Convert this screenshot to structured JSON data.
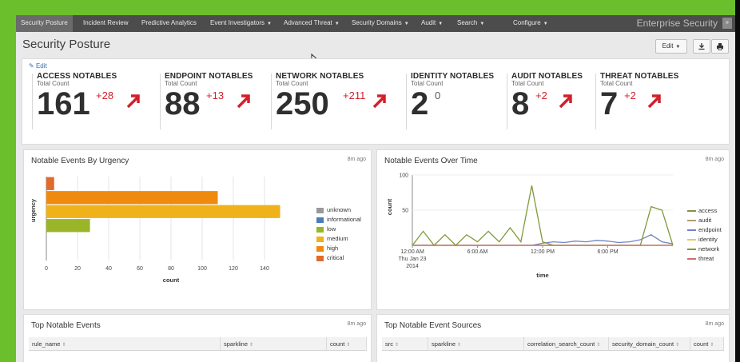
{
  "nav": {
    "items": [
      {
        "label": "Security Posture",
        "active": true,
        "caret": false
      },
      {
        "label": "Incident Review",
        "caret": false
      },
      {
        "label": "Predictive Analytics",
        "caret": false
      },
      {
        "label": "Event Investigators",
        "caret": true
      },
      {
        "label": "Advanced Threat",
        "caret": true
      },
      {
        "label": "Security Domains",
        "caret": true
      },
      {
        "label": "Audit",
        "caret": true
      },
      {
        "label": "Search",
        "caret": true
      },
      {
        "label": "Configure",
        "caret": true
      }
    ],
    "brand": "Enterprise Security",
    "brand_icon": "»"
  },
  "page": {
    "title": "Security Posture",
    "edit_button": "Edit",
    "edit_link": "Edit"
  },
  "kpis": [
    {
      "label": "ACCESS NOTABLES",
      "sub": "Total Count",
      "value": "161",
      "delta": "+28",
      "trend": "up"
    },
    {
      "label": "ENDPOINT NOTABLES",
      "sub": "Total Count",
      "value": "88",
      "delta": "+13",
      "trend": "up"
    },
    {
      "label": "NETWORK NOTABLES",
      "sub": "Total Count",
      "value": "250",
      "delta": "+211",
      "trend": "up"
    },
    {
      "label": "IDENTITY NOTABLES",
      "sub": "Total Count",
      "value": "2",
      "delta": "0",
      "trend": "none"
    },
    {
      "label": "AUDIT NOTABLES",
      "sub": "Total Count",
      "value": "8",
      "delta": "+2",
      "trend": "up"
    },
    {
      "label": "THREAT NOTABLES",
      "sub": "Total Count",
      "value": "7",
      "delta": "+2",
      "trend": "up"
    }
  ],
  "colors": {
    "accent_red": "#d0212b",
    "unknown": "#999999",
    "informational": "#4a7ebb",
    "low": "#9bb529",
    "medium": "#f0b21a",
    "high": "#f08a0e",
    "critical": "#e26a2c",
    "access": "#8a8f44",
    "audit": "#b79a6e",
    "endpoint": "#6f86c6",
    "identity": "#e8c85a",
    "network": "#7f9a3a",
    "threat": "#cf6f6f"
  },
  "urgency_panel": {
    "title": "Notable Events By Urgency",
    "ago": "8m ago",
    "chart_data": {
      "type": "bar",
      "orientation": "horizontal",
      "categories": [
        "critical",
        "high",
        "medium",
        "low",
        "informational",
        "unknown"
      ],
      "values": [
        5,
        110,
        150,
        28,
        0,
        0
      ],
      "xlabel": "count",
      "ylabel": "urgency",
      "xlim": [
        0,
        160
      ],
      "xticks": [
        "0",
        "20",
        "40",
        "60",
        "80",
        "100",
        "120",
        "140"
      ],
      "legend": [
        "unknown",
        "informational",
        "low",
        "medium",
        "high",
        "critical"
      ],
      "legend_position": "right",
      "grid": true
    }
  },
  "time_panel": {
    "title": "Notable Events Over Time",
    "ago": "8m ago",
    "chart_data": {
      "type": "line",
      "xlabel": "time",
      "ylabel": "count",
      "ylim": [
        0,
        100
      ],
      "yticks": [
        "100",
        "50"
      ],
      "xticks": [
        {
          "label": "12:00 AM",
          "sub": "Thu Jan 23",
          "sub2": "2014"
        },
        {
          "label": "6:00 AM"
        },
        {
          "label": "12:00 PM"
        },
        {
          "label": "6:00 PM"
        }
      ],
      "x_hours": [
        0,
        1,
        2,
        3,
        4,
        5,
        6,
        7,
        8,
        9,
        10,
        11,
        12,
        13,
        14,
        15,
        16,
        17,
        18,
        19,
        20,
        21,
        22,
        23,
        24
      ],
      "series": [
        {
          "name": "access",
          "values": [
            0,
            0,
            0,
            0,
            0,
            0,
            0,
            0,
            0,
            0,
            0,
            0,
            0,
            0,
            0,
            0,
            0,
            0,
            0,
            0,
            0,
            0,
            0,
            0,
            0
          ]
        },
        {
          "name": "audit",
          "values": [
            0,
            0,
            0,
            0,
            0,
            0,
            0,
            0,
            0,
            0,
            0,
            0,
            0,
            0,
            0,
            0,
            0,
            0,
            0,
            0,
            0,
            0,
            0,
            0,
            0
          ]
        },
        {
          "name": "endpoint",
          "values": [
            0,
            0,
            0,
            0,
            0,
            0,
            0,
            0,
            0,
            0,
            0,
            0,
            3,
            5,
            4,
            6,
            5,
            7,
            6,
            4,
            5,
            8,
            15,
            5,
            2
          ]
        },
        {
          "name": "identity",
          "values": [
            0,
            0,
            0,
            0,
            0,
            0,
            0,
            0,
            0,
            0,
            0,
            0,
            0,
            0,
            0,
            0,
            0,
            0,
            0,
            0,
            0,
            0,
            0,
            0,
            0
          ]
        },
        {
          "name": "network",
          "values": [
            0,
            20,
            0,
            15,
            0,
            15,
            5,
            20,
            5,
            25,
            5,
            85,
            5,
            0,
            0,
            0,
            0,
            0,
            0,
            0,
            0,
            0,
            55,
            50,
            0
          ]
        },
        {
          "name": "threat",
          "values": [
            0,
            0,
            0,
            0,
            0,
            0,
            0,
            0,
            0,
            0,
            0,
            0,
            0,
            0,
            0,
            0,
            0,
            0,
            0,
            0,
            0,
            0,
            0,
            0,
            0
          ]
        }
      ],
      "legend_position": "right",
      "grid": true
    }
  },
  "top_events_panel": {
    "title": "Top Notable Events",
    "ago": "8m ago",
    "columns": [
      "rule_name",
      "sparkline",
      "count"
    ]
  },
  "top_sources_panel": {
    "title": "Top Notable Event Sources",
    "ago": "8m ago",
    "columns": [
      "src",
      "sparkline",
      "correlation_search_count",
      "security_domain_count",
      "count"
    ]
  }
}
